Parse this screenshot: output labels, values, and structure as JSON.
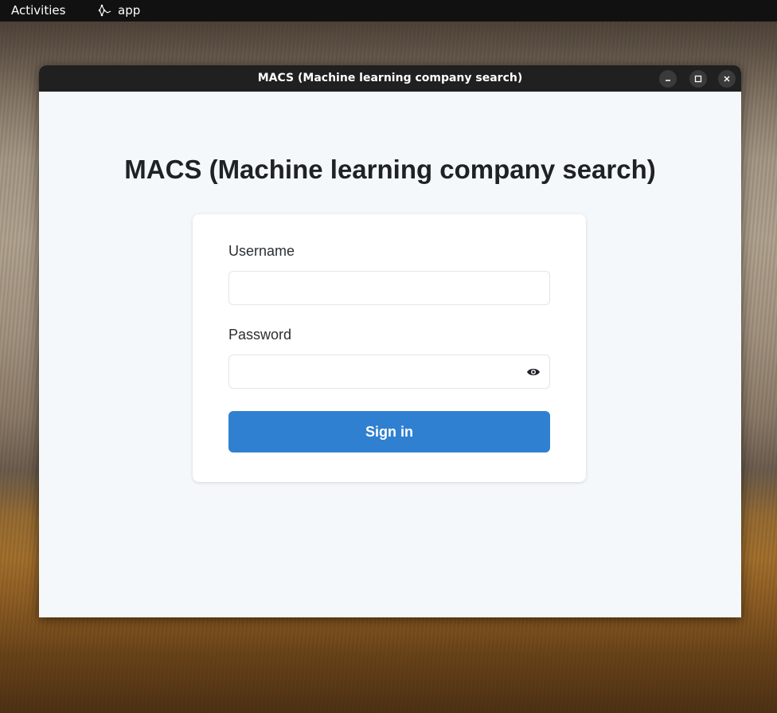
{
  "topbar": {
    "activities_label": "Activities",
    "app_label": "app",
    "app_icon": "app-icon"
  },
  "window": {
    "title": "MACS (Machine learning company search)",
    "controls": {
      "minimize_icon": "minimize-icon",
      "maximize_icon": "maximize-icon",
      "close_icon": "close-icon"
    }
  },
  "page": {
    "heading": "MACS (Machine learning company search)",
    "form": {
      "username_label": "Username",
      "username_value": "",
      "password_label": "Password",
      "password_value": "",
      "password_toggle_icon": "eye-icon",
      "submit_label": "Sign in"
    }
  },
  "colors": {
    "accent": "#2f80d0",
    "page_background": "#f5f8fb",
    "titlebar": "#202020",
    "topbar": "#111111"
  }
}
